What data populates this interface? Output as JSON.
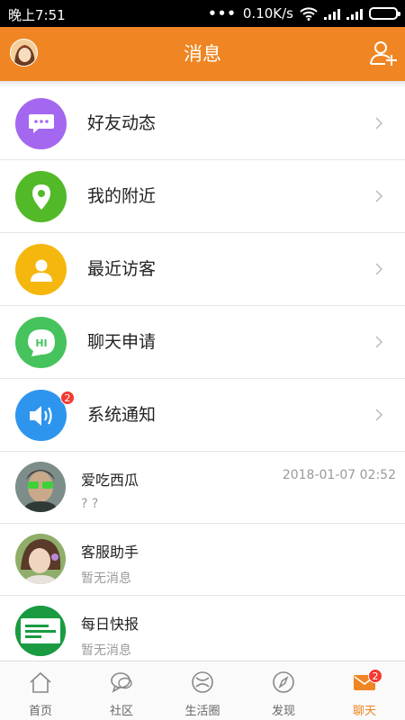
{
  "status_bar": {
    "time": "晚上7:51",
    "dots": "•••",
    "speed": "0.10K/s"
  },
  "header": {
    "title": "消息"
  },
  "menu": [
    {
      "label": "好友动态",
      "color": "#a467f0",
      "icon": "chat-bubble-icon"
    },
    {
      "label": "我的附近",
      "color": "#52b928",
      "icon": "location-pin-icon"
    },
    {
      "label": "最近访客",
      "color": "#f5b70d",
      "icon": "person-icon"
    },
    {
      "label": "聊天申请",
      "color": "#46c35d",
      "icon": "hi-bubble-icon"
    },
    {
      "label": "系统通知",
      "color": "#2e95ee",
      "icon": "speaker-icon",
      "badge": "2"
    }
  ],
  "conversations": [
    {
      "name": "爱吃西瓜",
      "message": "? ?",
      "time": "2018-01-07 02:52"
    },
    {
      "name": "客服助手",
      "message": "暂无消息",
      "time": ""
    },
    {
      "name": "每日快报",
      "message": "暂无消息",
      "time": ""
    }
  ],
  "tabs": [
    {
      "label": "首页",
      "icon": "home-icon"
    },
    {
      "label": "社区",
      "icon": "community-icon"
    },
    {
      "label": "生活圈",
      "icon": "life-circle-icon"
    },
    {
      "label": "发现",
      "icon": "compass-icon"
    },
    {
      "label": "聊天",
      "icon": "mail-icon",
      "badge": "2",
      "active": true
    }
  ],
  "colors": {
    "accent": "#ef8623",
    "badge": "#f23a30"
  }
}
